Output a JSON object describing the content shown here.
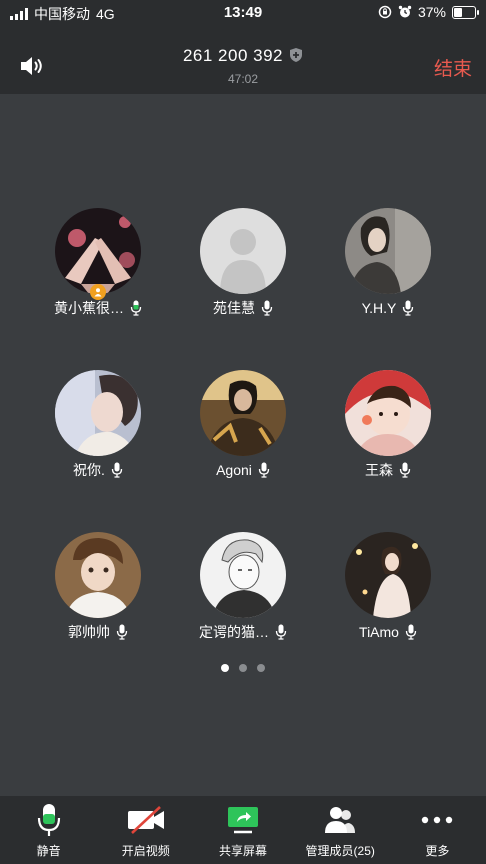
{
  "status_bar": {
    "carrier": "中国移动",
    "network": "4G",
    "time": "13:49",
    "battery_percent": "37%",
    "battery_level": 0.37
  },
  "header": {
    "meeting_id": "261 200 392",
    "duration": "47:02",
    "end_label": "结束",
    "end_color": "#e85a4f"
  },
  "participants": [
    {
      "name": "黄小蕉很…",
      "mic": "active",
      "is_host": true
    },
    {
      "name": "苑佳慧",
      "mic": "on",
      "is_host": false
    },
    {
      "name": "Y.H.Y",
      "mic": "on",
      "is_host": false
    },
    {
      "name": "祝你.",
      "mic": "on",
      "is_host": false
    },
    {
      "name": "Agoni",
      "mic": "on",
      "is_host": false
    },
    {
      "name": "王森",
      "mic": "on",
      "is_host": false
    },
    {
      "name": "郭帅帅",
      "mic": "on",
      "is_host": false
    },
    {
      "name": "定谔的猫…",
      "mic": "on",
      "is_host": false
    },
    {
      "name": "TiAmo",
      "mic": "on",
      "is_host": false
    }
  ],
  "pagination": {
    "pages": 3,
    "current": 1
  },
  "toolbar": {
    "mute_label": "静音",
    "video_label": "开启视频",
    "share_label": "共享屏幕",
    "members_label": "管理成员(25)",
    "more_label": "更多",
    "accent_green": "#2ec45a",
    "accent_red": "#e0453a"
  }
}
